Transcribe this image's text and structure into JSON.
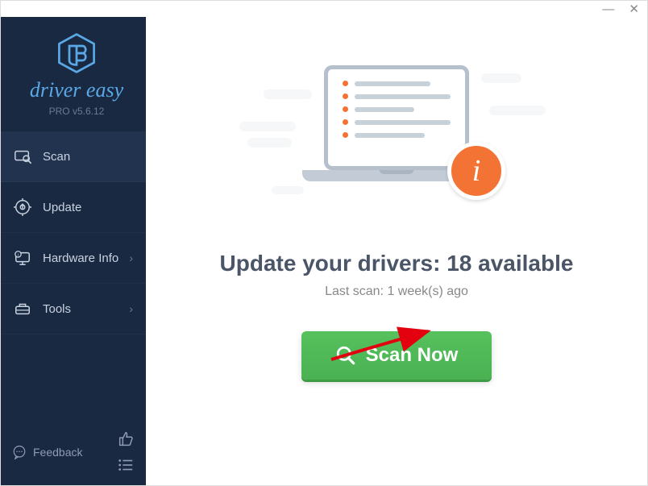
{
  "titlebar": {
    "minimize": "—",
    "close": "✕"
  },
  "brand": {
    "name": "driver easy",
    "version": "PRO v5.6.12"
  },
  "nav": {
    "items": [
      {
        "label": "Scan",
        "has_chevron": false
      },
      {
        "label": "Update",
        "has_chevron": false
      },
      {
        "label": "Hardware Info",
        "has_chevron": true
      },
      {
        "label": "Tools",
        "has_chevron": true
      }
    ]
  },
  "footer": {
    "feedback_label": "Feedback"
  },
  "main": {
    "headline_prefix": "Update your drivers: ",
    "available_count": 18,
    "headline_suffix": " available",
    "last_scan": "Last scan: 1 week(s) ago",
    "scan_button": "Scan Now",
    "info_badge": "i"
  },
  "chevron_glyph": "›"
}
